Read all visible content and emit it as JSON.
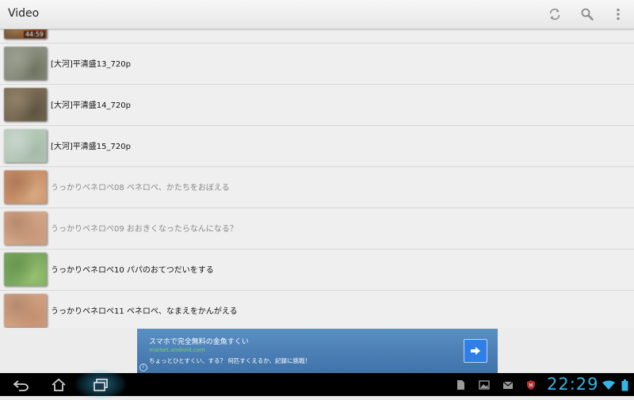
{
  "app": {
    "title": "Video"
  },
  "list": {
    "items": [
      {
        "title": "",
        "duration": "44:59",
        "text_color": "#333333",
        "thumb": [
          "#7a5a3a",
          "#a04a2a",
          "#c8b070"
        ]
      },
      {
        "title": "[大河]平清盛13_720p",
        "duration": "",
        "text_color": "#111111",
        "thumb": [
          "#8a8f80",
          "#6f7460",
          "#9a9f8f"
        ]
      },
      {
        "title": "[大河]平清盛14_720p",
        "duration": "",
        "text_color": "#111111",
        "thumb": [
          "#7a6a55",
          "#5e5442",
          "#8f8066"
        ]
      },
      {
        "title": "[大河]平清盛15_720p",
        "duration": "",
        "text_color": "#111111",
        "thumb": [
          "#b4c8b8",
          "#a6baa9",
          "#c8d6cc"
        ]
      },
      {
        "title": "うっかりペネロペ08 ペネロペ、かたちをおぼえる",
        "duration": "",
        "text_color": "#888888",
        "thumb": [
          "#c8906a",
          "#d8aa80",
          "#b07a58"
        ]
      },
      {
        "title": "うっかりペネロペ09 おおきくなったらなんになる？",
        "duration": "",
        "text_color": "#888888",
        "thumb": [
          "#d2a488",
          "#c89878",
          "#b88a6c"
        ]
      },
      {
        "title": "うっかりペネロペ10 パパのおてつだいをする",
        "duration": "",
        "text_color": "#111111",
        "thumb": [
          "#7aa860",
          "#98c070",
          "#6a9650"
        ]
      },
      {
        "title": "うっかりペネロペ11 ペネロペ、なまえをかんがえる",
        "duration": "",
        "text_color": "#111111",
        "thumb": [
          "#d0a080",
          "#c49070",
          "#b68a70"
        ]
      }
    ]
  },
  "ad": {
    "title": "スマホで完全無料の金魚すくい",
    "url": "market.android.com",
    "text": "ちょっとひとすくい、する？ 何匹すくえるか、記録に挑戦！",
    "info": "i"
  },
  "statusbar": {
    "time": "22:29"
  },
  "colors": {
    "accent": "#33b5e5",
    "ad_bg": "#4a7fb5",
    "ad_button": "#2f7fe6"
  }
}
